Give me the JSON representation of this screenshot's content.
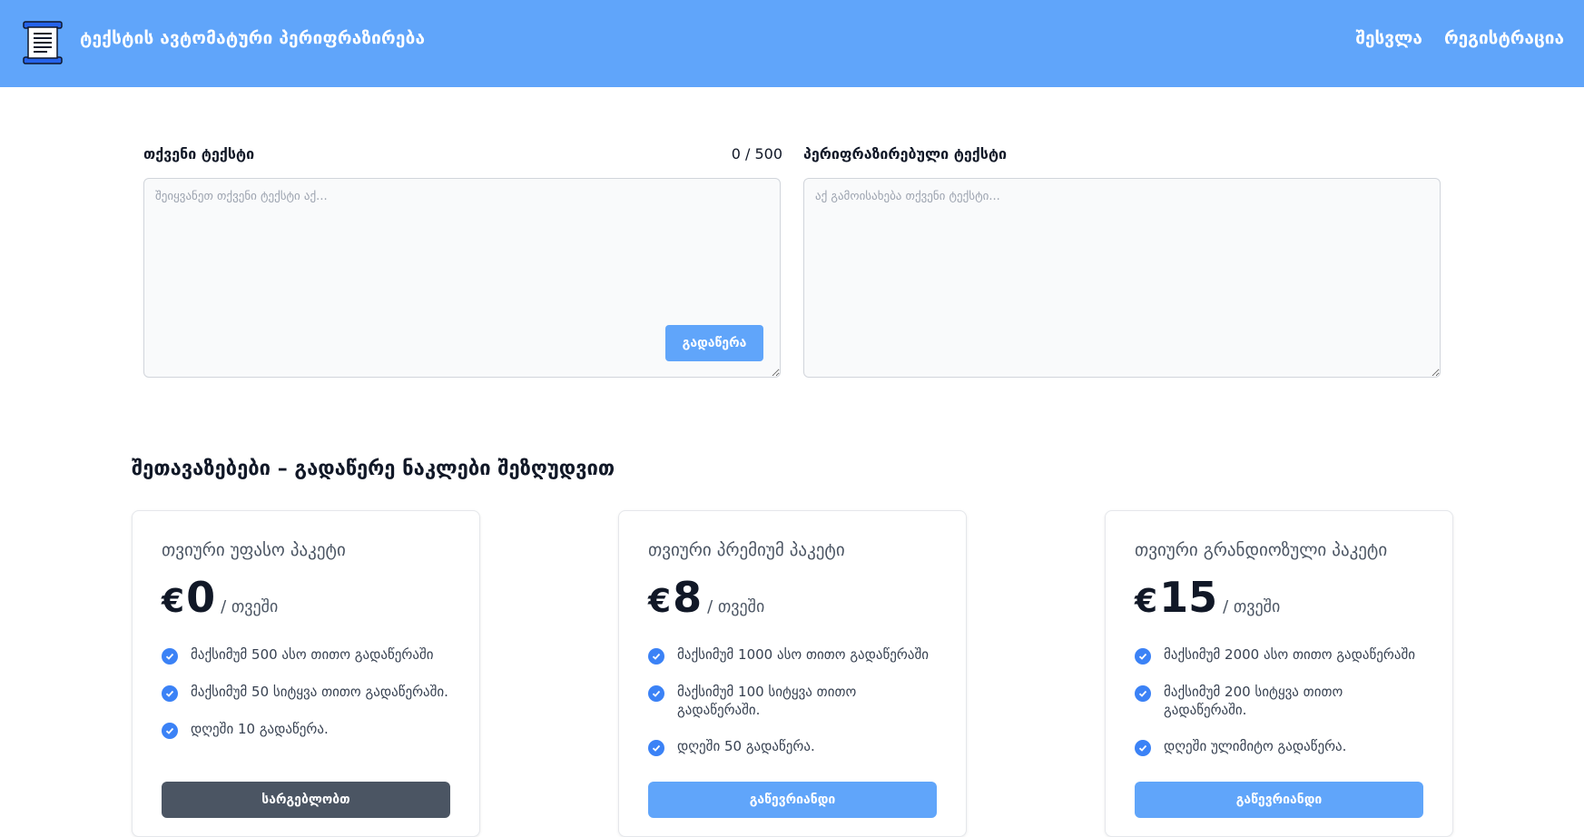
{
  "header": {
    "title": "ტექსტის ავტომატური პერიფრაზირება",
    "logo_icon": "scroll-document-icon",
    "nav": [
      {
        "label": "შესვლა"
      },
      {
        "label": "რეგისტრაცია"
      }
    ]
  },
  "editor": {
    "input_label": "თქვენი ტექსტი",
    "counter": "0 / 500",
    "input_placeholder": "შეიყვანეთ თქვენი ტექსტი აქ...",
    "output_label": "პერიფრაზირებული ტექსტი",
    "output_placeholder": "აქ გამოისახება თქვენი ტექსტი...",
    "rewrite_button": "გადაწერა"
  },
  "pricing": {
    "title": "შეთავაზებები – გადაწერე ნაკლები შეზღუდვით",
    "plans": [
      {
        "name": "თვიური უფასო პაკეტი",
        "currency": "€",
        "price": "0",
        "period": "/ თვეში",
        "features": [
          "მაქსიმუმ 500 ასო თითო გადაწერაში",
          "მაქსიმუმ 50 სიტყვა თითო გადაწერაში.",
          "დღეში 10 გადაწერა."
        ],
        "button": "სარგებლობთ",
        "button_color": "#4b5563"
      },
      {
        "name": "თვიური პრემიუმ პაკეტი",
        "currency": "€",
        "price": "8",
        "period": "/ თვეში",
        "features": [
          "მაქსიმუმ 1000 ასო თითო გადაწერაში",
          "მაქსიმუმ 100 სიტყვა თითო გადაწერაში.",
          "დღეში 50 გადაწერა."
        ],
        "button": "გაწევრიანდი",
        "button_color": "#60a5fa"
      },
      {
        "name": "თვიური გრანდიოზული პაკეტი",
        "currency": "€",
        "price": "15",
        "period": "/ თვეში",
        "features": [
          "მაქსიმუმ 2000 ასო თითო გადაწერაში",
          "მაქსიმუმ 200 სიტყვა თითო გადაწერაში.",
          "დღეში ულიმიტო გადაწერა."
        ],
        "button": "გაწევრიანდი",
        "button_color": "#60a5fa"
      }
    ]
  },
  "colors": {
    "header_bg": "#60a5fa",
    "accent": "#3b82f6",
    "muted_button": "#4b5563"
  }
}
